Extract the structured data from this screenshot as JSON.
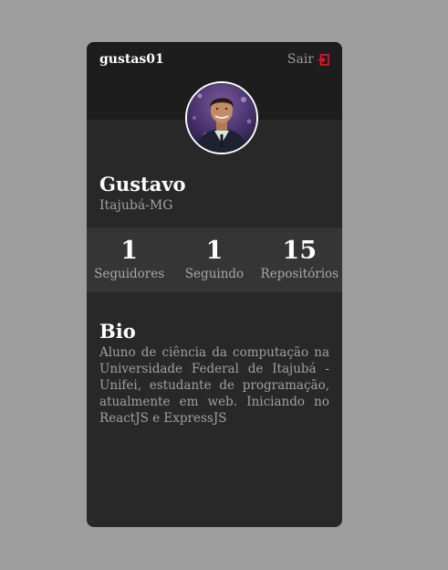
{
  "profile": {
    "username": "gustas01",
    "logout_label": "Sair",
    "name": "Gustavo",
    "location": "Itajubá-MG"
  },
  "stats": [
    {
      "value": "1",
      "label": "Seguidores"
    },
    {
      "value": "1",
      "label": "Seguindo"
    },
    {
      "value": "15",
      "label": "Repositórios"
    }
  ],
  "bio": {
    "title": "Bio",
    "text": "Aluno de ciência da computação na Universidade Federal de Itajubá - Unifei, estudante de programação, atualmente em web. Iniciando no ReactJS e ExpressJS"
  },
  "colors": {
    "background": "#9e9e9e",
    "card": "#282828",
    "header": "#1d1d1d",
    "stats_bar": "#353535",
    "logout_icon": "#e0192b"
  },
  "icons": {
    "logout": "sign-out-icon",
    "avatar": "user-photo"
  }
}
